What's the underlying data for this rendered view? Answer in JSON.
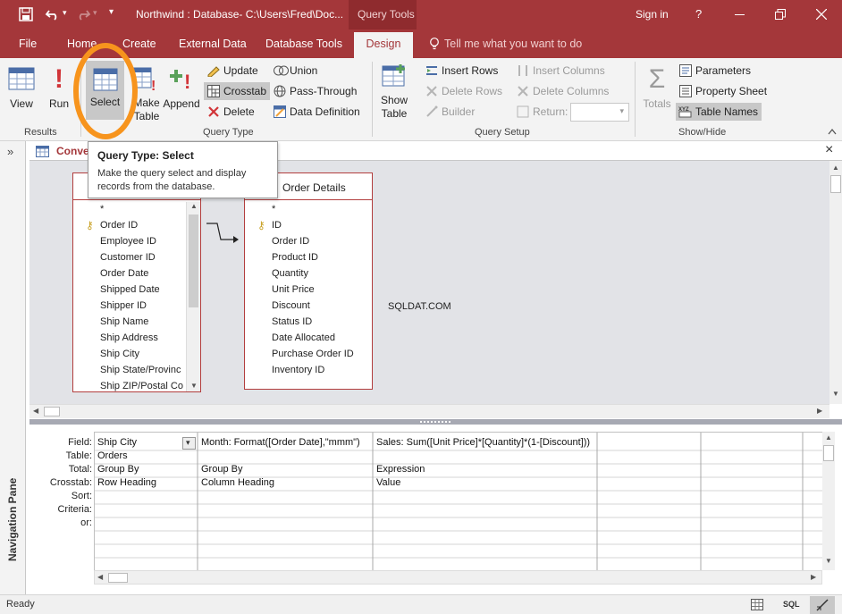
{
  "title_bar": {
    "doc_title": "Northwind : Database- C:\\Users\\Fred\\Doc...",
    "context_tab": "Query Tools",
    "sign_in": "Sign in",
    "help": "?"
  },
  "tabs": [
    "File",
    "Home",
    "Create",
    "External Data",
    "Database Tools",
    "Design"
  ],
  "active_tab": "Design",
  "tell_me": "Tell me what you want to do",
  "ribbon": {
    "results": {
      "label": "Results",
      "view": "View",
      "run": "Run"
    },
    "query_type": {
      "label": "Query Type",
      "select": "Select",
      "make_table_1": "Make",
      "make_table_2": "Table",
      "append": "Append",
      "update": "Update",
      "crosstab": "Crosstab",
      "delete": "Delete",
      "union": "Union",
      "pass_through": "Pass-Through",
      "data_definition": "Data Definition"
    },
    "query_setup": {
      "label": "Query Setup",
      "show_table_1": "Show",
      "show_table_2": "Table",
      "insert_rows": "Insert Rows",
      "delete_rows": "Delete Rows",
      "builder": "Builder",
      "insert_columns": "Insert Columns",
      "delete_columns": "Delete Columns",
      "return": "Return:"
    },
    "show_hide": {
      "label": "Show/Hide",
      "totals": "Totals",
      "parameters": "Parameters",
      "property_sheet": "Property Sheet",
      "table_names": "Table Names"
    }
  },
  "tooltip": {
    "title": "Query Type: Select",
    "body_1": "Make the query select and display",
    "body_2": "records from the database."
  },
  "nav_pane": {
    "label": "Navigation Pane",
    "toggle": "»"
  },
  "doc_tab": {
    "label": "Conve",
    "close": "×"
  },
  "orders_table": {
    "fields": [
      "*",
      "Order ID",
      "Employee ID",
      "Customer ID",
      "Order Date",
      "Shipped Date",
      "Shipper ID",
      "Ship Name",
      "Ship Address",
      "Ship City",
      "Ship State/Provinc",
      "Ship ZIP/Postal Co"
    ]
  },
  "order_details_table": {
    "title": "Order Details",
    "fields": [
      "*",
      "ID",
      "Order ID",
      "Product ID",
      "Quantity",
      "Unit Price",
      "Discount",
      "Status ID",
      "Date Allocated",
      "Purchase Order ID",
      "Inventory ID"
    ]
  },
  "watermark": "SQLDAT.COM",
  "grid": {
    "row_labels": [
      "Field:",
      "Table:",
      "Total:",
      "Crosstab:",
      "Sort:",
      "Criteria:",
      "or:"
    ],
    "columns": [
      {
        "field": "Ship City",
        "table": "Orders",
        "total": "Group By",
        "crosstab": "Row Heading"
      },
      {
        "field": "Month: Format([Order Date],\"mmm\")",
        "table": "",
        "total": "Group By",
        "crosstab": "Column Heading"
      },
      {
        "field": "Sales: Sum([Unit Price]*[Quantity]*(1-[Discount]))",
        "table": "",
        "total": "Expression",
        "crosstab": "Value"
      }
    ]
  },
  "status": {
    "text": "Ready",
    "sql": "SQL"
  },
  "colors": {
    "accent": "#a4373a",
    "highlight_circle": "#f7941d",
    "active_button": "#c8c8c8"
  }
}
